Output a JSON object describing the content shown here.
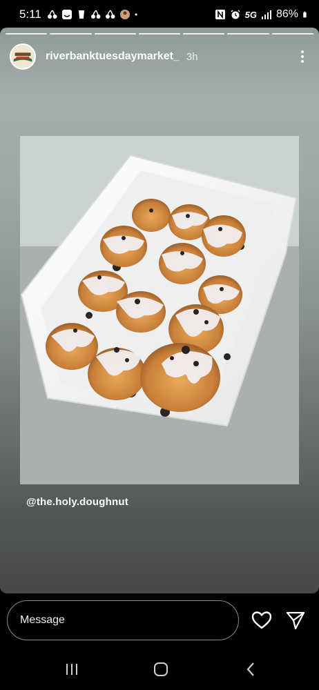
{
  "status_bar": {
    "time": "5:11",
    "network": "5G",
    "battery": "86%",
    "icons_left": [
      "cherry-icon",
      "smiley-app-icon",
      "cup-icon",
      "cherry-icon",
      "cherry-icon",
      "avatar-notification-icon",
      "dot-icon"
    ],
    "icons_right": [
      "nfc-icon",
      "alarm-icon",
      "network-5g-icon",
      "signal-icon",
      "battery-icon"
    ]
  },
  "story": {
    "progress_segments": 7,
    "username": "riverbanktuesdaymarket_",
    "time_ago": "3h",
    "avatar_text": [
      "RIVERBANK",
      "TUESDAY MARKET"
    ],
    "mention": "@the.holy.doughnut",
    "photo_subject": "cookies-and-cream mini doughnuts in paper tray"
  },
  "reply": {
    "placeholder": "Message"
  },
  "nav": {
    "buttons": [
      "recents-button",
      "home-button",
      "back-button"
    ]
  },
  "colors": {
    "background": "#000000",
    "story_top": "#a3ada9",
    "story_bottom": "#474948",
    "text": "#ffffff"
  }
}
